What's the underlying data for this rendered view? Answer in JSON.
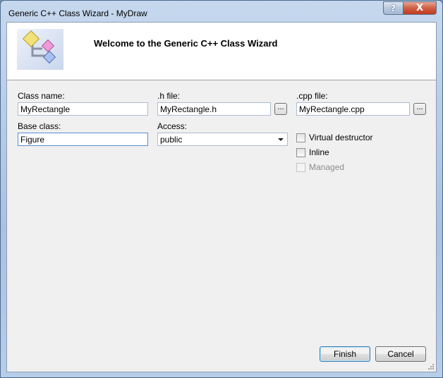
{
  "window": {
    "title": "Generic C++ Class Wizard - MyDraw",
    "help_symbol": "?",
    "close_symbol": "X"
  },
  "header": {
    "title": "Welcome to the Generic C++ Class Wizard",
    "icon": "class-wizard-diagram-icon"
  },
  "fields": {
    "class_name": {
      "label": "Class name:",
      "value": "MyRectangle"
    },
    "h_file": {
      "label": ".h file:",
      "value": "MyRectangle.h",
      "browse": "..."
    },
    "cpp_file": {
      "label": ".cpp file:",
      "value": "MyRectangle.cpp",
      "browse": "..."
    },
    "base_class": {
      "label": "Base class:",
      "value": "Figure"
    },
    "access": {
      "label": "Access:",
      "value": "public"
    }
  },
  "options": {
    "virtual_destructor": {
      "label": "Virtual destructor",
      "checked": false,
      "enabled": true
    },
    "inline": {
      "label": "Inline",
      "checked": false,
      "enabled": true
    },
    "managed": {
      "label": "Managed",
      "checked": false,
      "enabled": false
    }
  },
  "buttons": {
    "finish": "Finish",
    "cancel": "Cancel"
  },
  "colors": {
    "header_bg": "#ffffff",
    "body_bg": "#f0f0f0",
    "frame": "#a9c2df",
    "close": "#c0391f"
  }
}
